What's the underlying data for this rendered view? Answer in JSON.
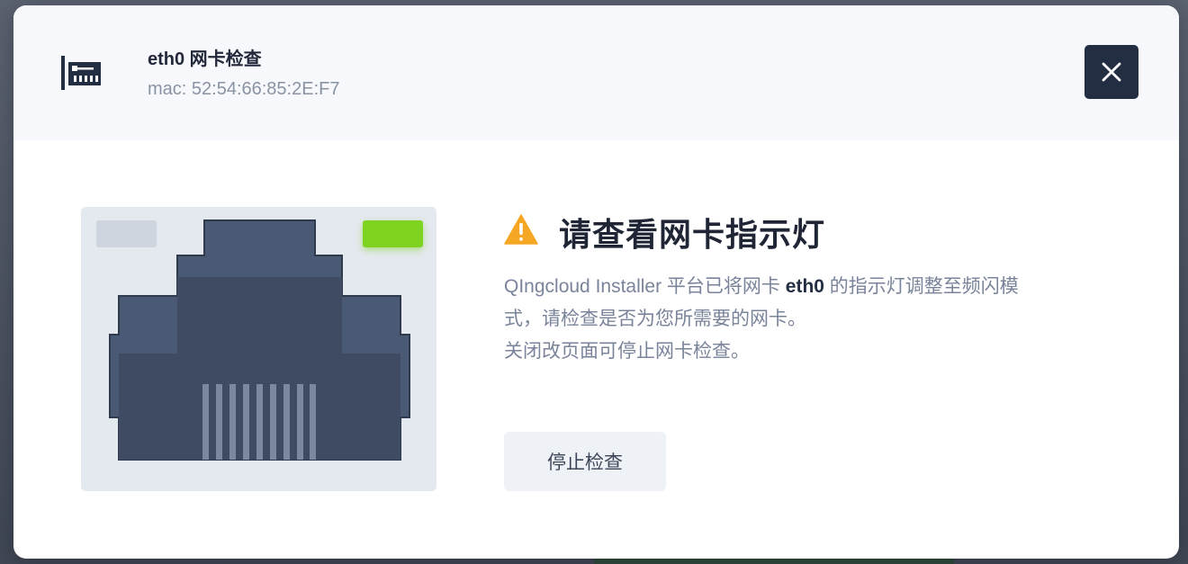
{
  "header": {
    "title": "eth0 网卡检查",
    "subtitle": "mac: 52:54:66:85:2E:F7",
    "icon": "network-card-icon",
    "close_icon": "close-icon"
  },
  "body": {
    "warning_title": "请查看网卡指示灯",
    "warning_icon": "warning-icon",
    "description": {
      "line1_prefix": "QIngcloud Installer 平台已将网卡 ",
      "line1_device": "eth0",
      "line1_suffix": " 的指示灯调整至频闪模",
      "line2": "式，请检查是否为您所需要的网卡。",
      "line3": "关闭改页面可停止网卡检查。"
    },
    "stop_button_label": "停止检查"
  },
  "port_illustration": {
    "icon": "ethernet-port-icon",
    "led_left_state": "off",
    "led_right_state": "on"
  },
  "colors": {
    "accent_dark": "#242e42",
    "warning": "#f5a623",
    "led_green": "#7ed321",
    "led_off": "#cfd5de",
    "port_dark": "#3e4b62",
    "port_mid": "#4a5a74",
    "panel_bg": "#e4e8ef"
  }
}
